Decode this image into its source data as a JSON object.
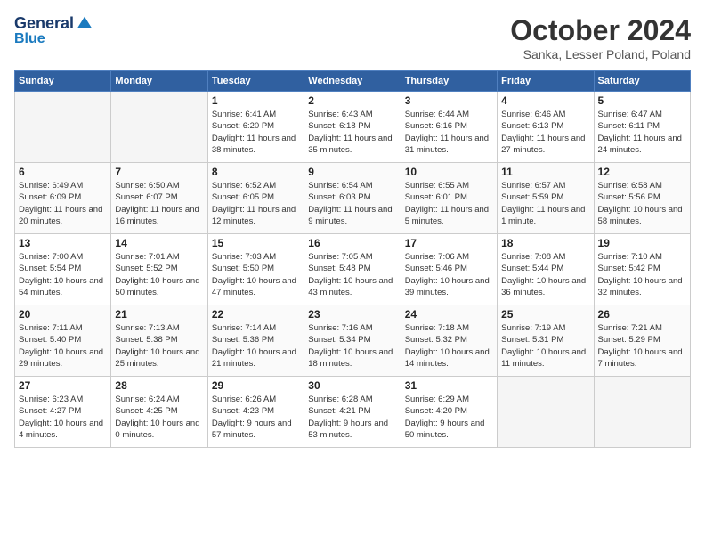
{
  "header": {
    "logo": {
      "general": "General",
      "blue": "Blue"
    },
    "title": "October 2024",
    "location": "Sanka, Lesser Poland, Poland"
  },
  "weekdays": [
    "Sunday",
    "Monday",
    "Tuesday",
    "Wednesday",
    "Thursday",
    "Friday",
    "Saturday"
  ],
  "weeks": [
    [
      {
        "day": null
      },
      {
        "day": null
      },
      {
        "day": "1",
        "sunrise": "6:41 AM",
        "sunset": "6:20 PM",
        "daylight": "11 hours and 38 minutes."
      },
      {
        "day": "2",
        "sunrise": "6:43 AM",
        "sunset": "6:18 PM",
        "daylight": "11 hours and 35 minutes."
      },
      {
        "day": "3",
        "sunrise": "6:44 AM",
        "sunset": "6:16 PM",
        "daylight": "11 hours and 31 minutes."
      },
      {
        "day": "4",
        "sunrise": "6:46 AM",
        "sunset": "6:13 PM",
        "daylight": "11 hours and 27 minutes."
      },
      {
        "day": "5",
        "sunrise": "6:47 AM",
        "sunset": "6:11 PM",
        "daylight": "11 hours and 24 minutes."
      }
    ],
    [
      {
        "day": "6",
        "sunrise": "6:49 AM",
        "sunset": "6:09 PM",
        "daylight": "11 hours and 20 minutes."
      },
      {
        "day": "7",
        "sunrise": "6:50 AM",
        "sunset": "6:07 PM",
        "daylight": "11 hours and 16 minutes."
      },
      {
        "day": "8",
        "sunrise": "6:52 AM",
        "sunset": "6:05 PM",
        "daylight": "11 hours and 12 minutes."
      },
      {
        "day": "9",
        "sunrise": "6:54 AM",
        "sunset": "6:03 PM",
        "daylight": "11 hours and 9 minutes."
      },
      {
        "day": "10",
        "sunrise": "6:55 AM",
        "sunset": "6:01 PM",
        "daylight": "11 hours and 5 minutes."
      },
      {
        "day": "11",
        "sunrise": "6:57 AM",
        "sunset": "5:59 PM",
        "daylight": "11 hours and 1 minute."
      },
      {
        "day": "12",
        "sunrise": "6:58 AM",
        "sunset": "5:56 PM",
        "daylight": "10 hours and 58 minutes."
      }
    ],
    [
      {
        "day": "13",
        "sunrise": "7:00 AM",
        "sunset": "5:54 PM",
        "daylight": "10 hours and 54 minutes."
      },
      {
        "day": "14",
        "sunrise": "7:01 AM",
        "sunset": "5:52 PM",
        "daylight": "10 hours and 50 minutes."
      },
      {
        "day": "15",
        "sunrise": "7:03 AM",
        "sunset": "5:50 PM",
        "daylight": "10 hours and 47 minutes."
      },
      {
        "day": "16",
        "sunrise": "7:05 AM",
        "sunset": "5:48 PM",
        "daylight": "10 hours and 43 minutes."
      },
      {
        "day": "17",
        "sunrise": "7:06 AM",
        "sunset": "5:46 PM",
        "daylight": "10 hours and 39 minutes."
      },
      {
        "day": "18",
        "sunrise": "7:08 AM",
        "sunset": "5:44 PM",
        "daylight": "10 hours and 36 minutes."
      },
      {
        "day": "19",
        "sunrise": "7:10 AM",
        "sunset": "5:42 PM",
        "daylight": "10 hours and 32 minutes."
      }
    ],
    [
      {
        "day": "20",
        "sunrise": "7:11 AM",
        "sunset": "5:40 PM",
        "daylight": "10 hours and 29 minutes."
      },
      {
        "day": "21",
        "sunrise": "7:13 AM",
        "sunset": "5:38 PM",
        "daylight": "10 hours and 25 minutes."
      },
      {
        "day": "22",
        "sunrise": "7:14 AM",
        "sunset": "5:36 PM",
        "daylight": "10 hours and 21 minutes."
      },
      {
        "day": "23",
        "sunrise": "7:16 AM",
        "sunset": "5:34 PM",
        "daylight": "10 hours and 18 minutes."
      },
      {
        "day": "24",
        "sunrise": "7:18 AM",
        "sunset": "5:32 PM",
        "daylight": "10 hours and 14 minutes."
      },
      {
        "day": "25",
        "sunrise": "7:19 AM",
        "sunset": "5:31 PM",
        "daylight": "10 hours and 11 minutes."
      },
      {
        "day": "26",
        "sunrise": "7:21 AM",
        "sunset": "5:29 PM",
        "daylight": "10 hours and 7 minutes."
      }
    ],
    [
      {
        "day": "27",
        "sunrise": "6:23 AM",
        "sunset": "4:27 PM",
        "daylight": "10 hours and 4 minutes."
      },
      {
        "day": "28",
        "sunrise": "6:24 AM",
        "sunset": "4:25 PM",
        "daylight": "10 hours and 0 minutes."
      },
      {
        "day": "29",
        "sunrise": "6:26 AM",
        "sunset": "4:23 PM",
        "daylight": "9 hours and 57 minutes."
      },
      {
        "day": "30",
        "sunrise": "6:28 AM",
        "sunset": "4:21 PM",
        "daylight": "9 hours and 53 minutes."
      },
      {
        "day": "31",
        "sunrise": "6:29 AM",
        "sunset": "4:20 PM",
        "daylight": "9 hours and 50 minutes."
      },
      {
        "day": null
      },
      {
        "day": null
      }
    ]
  ],
  "labels": {
    "sunrise": "Sunrise:",
    "sunset": "Sunset:",
    "daylight": "Daylight:"
  }
}
